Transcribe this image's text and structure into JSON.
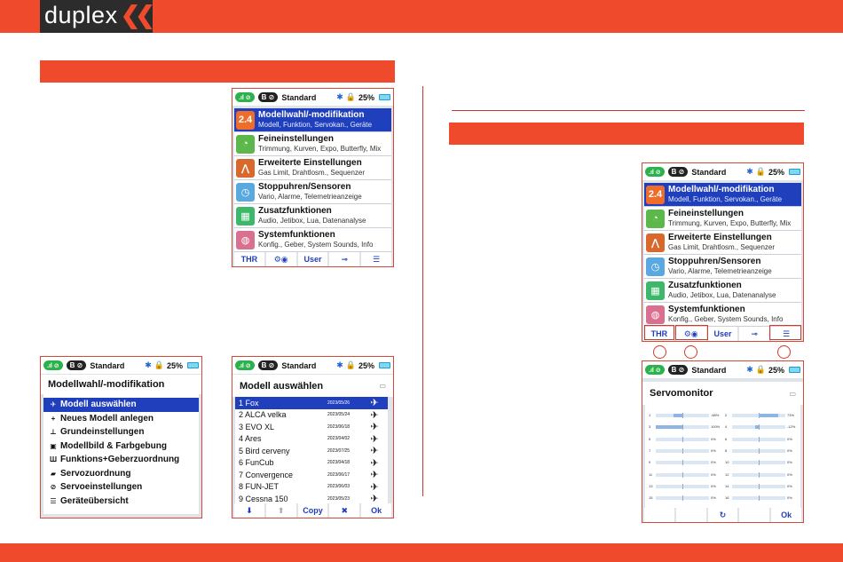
{
  "brand": {
    "logo": "duplex",
    "accent": "#ee4a2b"
  },
  "status": {
    "sig": ".ıl ⊘",
    "b": "B ⊘",
    "name": "Standard",
    "batt": "25%"
  },
  "menu": {
    "items": [
      {
        "title": "Modellwahl/-modifikation",
        "sub": "Modell, Funktion, Servokan., Geräte",
        "icon": "model-icon",
        "color": "#ee6d2b",
        "glyph": "2.4"
      },
      {
        "title": "Feineinstellungen",
        "sub": "Trimmung, Kurven, Expo, Butterfly, Mix",
        "icon": "gauge-icon",
        "color": "#5cb84a",
        "glyph": "◔"
      },
      {
        "title": "Erweiterte Einstellungen",
        "sub": "Gas Limit, Drahtlosm., Sequenzer",
        "icon": "tree-icon",
        "color": "#d9682c",
        "glyph": "⋀"
      },
      {
        "title": "Stoppuhren/Sensoren",
        "sub": "Vario, Alarme, Telemetrieanzeige",
        "icon": "clock-icon",
        "color": "#5aa8e0",
        "glyph": "◷"
      },
      {
        "title": "Zusatzfunktionen",
        "sub": "Audio, Jetibox, Lua, Datenanalyse",
        "icon": "grid-icon",
        "color": "#3db86a",
        "glyph": "▦"
      },
      {
        "title": "Systemfunktionen",
        "sub": "Konfig., Geber, System Sounds, Info",
        "icon": "globe-icon",
        "color": "#d97090",
        "glyph": "◍"
      }
    ],
    "buttons": [
      "THR",
      "⚙◉",
      "User",
      "⊸",
      "☰"
    ]
  },
  "modell": {
    "title": "Modellwahl/-modifikation",
    "items": [
      {
        "label": "Modell auswählen",
        "icon": "✈"
      },
      {
        "label": "Neues Modell anlegen",
        "icon": "+"
      },
      {
        "label": "Grundeinstellungen",
        "icon": "⊥"
      },
      {
        "label": "Modellbild & Farbgebung",
        "icon": "▣"
      },
      {
        "label": "Funktions+Geberzuordnung",
        "icon": "Ш"
      },
      {
        "label": "Servozuordnung",
        "icon": "▰"
      },
      {
        "label": "Servoeinstellungen",
        "icon": "⊘"
      },
      {
        "label": "Geräteübersicht",
        "icon": "☰"
      }
    ]
  },
  "auswahl": {
    "title": "Modell auswählen",
    "rows": [
      {
        "name": "1 Fox",
        "date": "2023/05/26"
      },
      {
        "name": "2 ALCA velka",
        "date": "2023/05/24"
      },
      {
        "name": "3 EVO XL",
        "date": "2023/06/18"
      },
      {
        "name": "4 Ares",
        "date": "2023/04/02"
      },
      {
        "name": "5 Bird cerveny",
        "date": "2023/07/25"
      },
      {
        "name": "6 FunCub",
        "date": "2023/04/18"
      },
      {
        "name": "7 Convergence",
        "date": "2023/06/17"
      },
      {
        "name": "8 FUN-JET",
        "date": "2023/06/03"
      },
      {
        "name": "9 Cessna 150",
        "date": "2023/05/23"
      }
    ],
    "buttons": [
      "⬇",
      "⬆",
      "Copy",
      "✖",
      "Ok"
    ]
  },
  "servo": {
    "title": "Servomonitor",
    "left": [
      {
        "n": "1",
        "p": "-68%",
        "v": 0.34
      },
      {
        "n": "3",
        "p": "100%",
        "v": 0.0
      },
      {
        "n": "5",
        "p": "0%",
        "v": 0.5
      },
      {
        "n": "7",
        "p": "0%",
        "v": 0.5
      },
      {
        "n": "9",
        "p": "0%",
        "v": 0.5
      },
      {
        "n": "11",
        "p": "0%",
        "v": 0.5
      },
      {
        "n": "13",
        "p": "0%",
        "v": 0.5
      },
      {
        "n": "15",
        "p": "0%",
        "v": 0.5
      }
    ],
    "right": [
      {
        "n": "2",
        "p": "73%",
        "v": 0.86
      },
      {
        "n": "4",
        "p": "-12%",
        "v": 0.44
      },
      {
        "n": "6",
        "p": "0%",
        "v": 0.5
      },
      {
        "n": "8",
        "p": "0%",
        "v": 0.5
      },
      {
        "n": "10",
        "p": "0%",
        "v": 0.5
      },
      {
        "n": "12",
        "p": "0%",
        "v": 0.5
      },
      {
        "n": "14",
        "p": "0%",
        "v": 0.5
      },
      {
        "n": "16",
        "p": "0%",
        "v": 0.5
      }
    ],
    "buttons": [
      "",
      "",
      "↻",
      "",
      "Ok"
    ]
  }
}
